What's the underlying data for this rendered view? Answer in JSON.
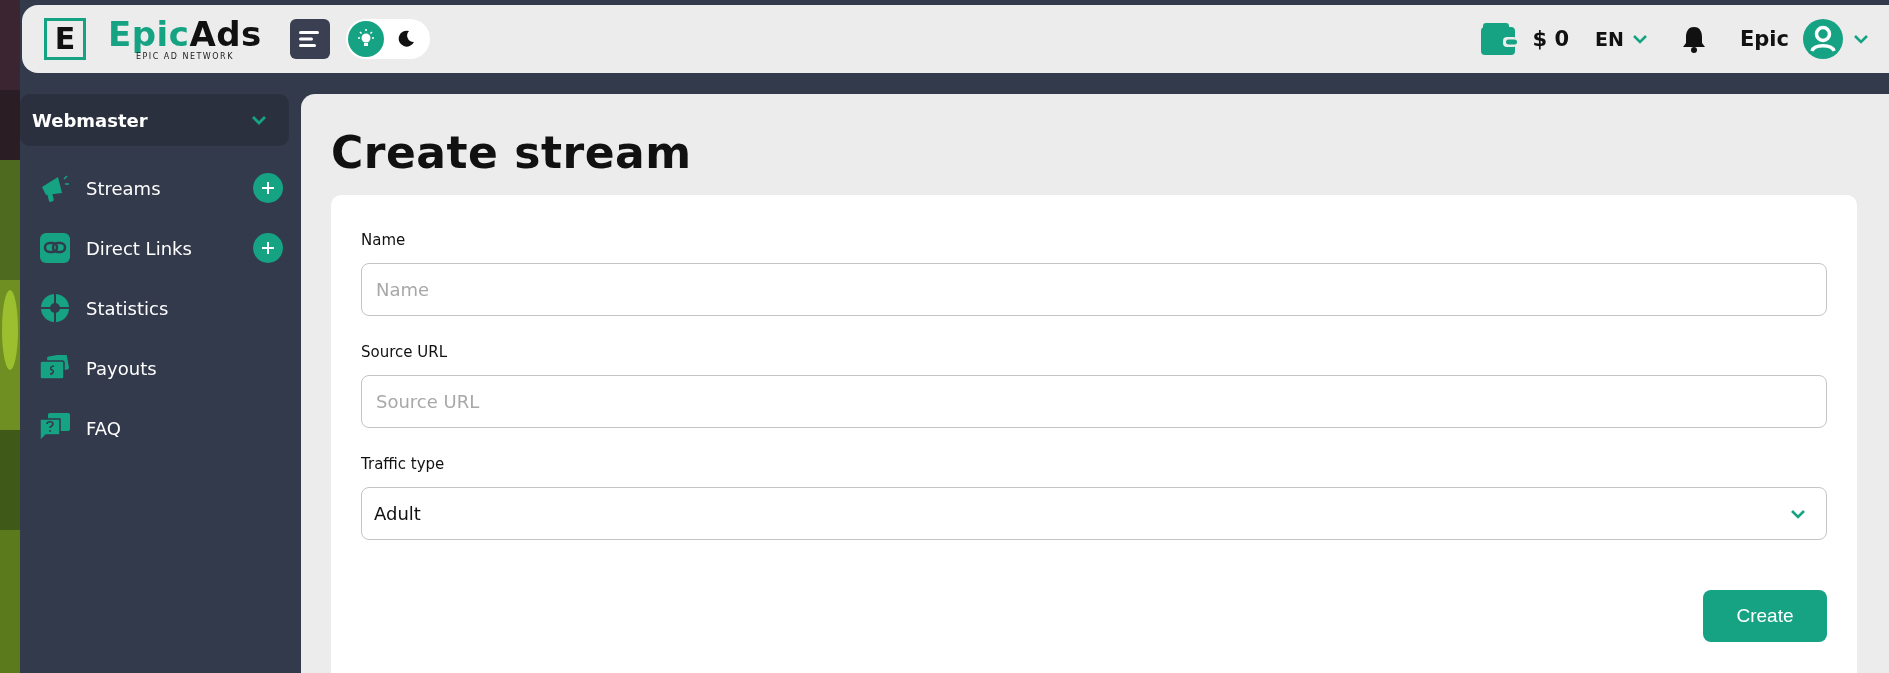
{
  "header": {
    "logo": {
      "letter": "E",
      "brand_part_1": "Epic",
      "brand_part_2": "Ads",
      "tagline": "EPIC AD NETWORK"
    },
    "theme_toggle": [
      {
        "kind": "light",
        "selected": true
      },
      {
        "kind": "dark",
        "selected": false
      }
    ],
    "balance": "$ 0",
    "language": "EN",
    "user": "Epic"
  },
  "sidebar": {
    "role": "Webmaster",
    "items": [
      {
        "label": "Streams",
        "addable": true
      },
      {
        "label": "Direct Links",
        "addable": true
      },
      {
        "label": "Statistics",
        "addable": false
      },
      {
        "label": "Payouts",
        "addable": false
      },
      {
        "label": "FAQ",
        "addable": false
      }
    ]
  },
  "page": {
    "title": "Create stream",
    "fields": [
      {
        "kind": "text",
        "label": "Name",
        "placeholder": "Name"
      },
      {
        "kind": "text",
        "label": "Source URL",
        "placeholder": "Source URL"
      },
      {
        "kind": "select",
        "label": "Traffic type",
        "value": "Adult"
      }
    ],
    "submit": "Create"
  }
}
